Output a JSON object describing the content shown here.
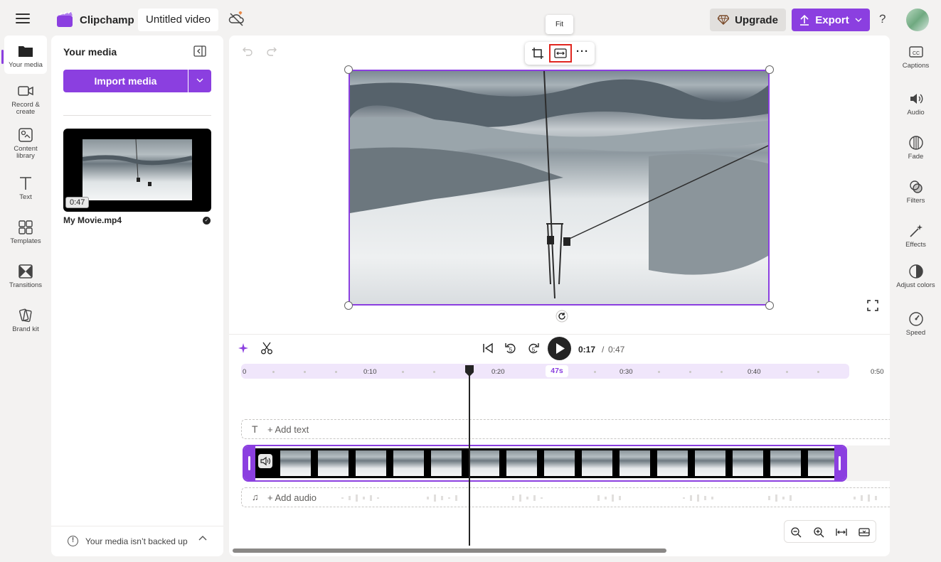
{
  "app": {
    "brand": "Clipchamp",
    "project_title": "Untitled video",
    "upgrade_label": "Upgrade",
    "export_label": "Export",
    "help_label": "?"
  },
  "left_nav": {
    "items": [
      {
        "label": "Your media",
        "icon": "folder-icon"
      },
      {
        "label": "Record & create",
        "icon": "camera-icon"
      },
      {
        "label": "Content library",
        "icon": "library-icon"
      },
      {
        "label": "Text",
        "icon": "text-icon"
      },
      {
        "label": "Templates",
        "icon": "templates-icon"
      },
      {
        "label": "Transitions",
        "icon": "transitions-icon"
      },
      {
        "label": "Brand kit",
        "icon": "brand-kit-icon"
      }
    ]
  },
  "media_panel": {
    "title": "Your media",
    "import_label": "Import media",
    "item": {
      "duration": "0:47",
      "name": "My Movie.mp4"
    },
    "backup_notice": "Your media isn’t backed up"
  },
  "preview": {
    "tooltip": "Fit",
    "more_label": "···"
  },
  "playback": {
    "current_time": "0:17",
    "separator": "/",
    "total_time": "0:47",
    "skip_back_label": "5",
    "skip_fwd_label": "5"
  },
  "timeline": {
    "ticks": [
      "0",
      "0:10",
      "0:20",
      "0:30",
      "0:40",
      "0:50"
    ],
    "duration_badge": "47s",
    "add_text_label": "+ Add text",
    "add_audio_label": "+ Add audio"
  },
  "right_nav": {
    "items": [
      {
        "label": "Captions",
        "icon": "captions-icon"
      },
      {
        "label": "Audio",
        "icon": "speaker-icon"
      },
      {
        "label": "Fade",
        "icon": "fade-icon"
      },
      {
        "label": "Filters",
        "icon": "filters-icon"
      },
      {
        "label": "Effects",
        "icon": "effects-wand-icon"
      },
      {
        "label": "Adjust colors",
        "icon": "adjust-colors-icon"
      },
      {
        "label": "Speed",
        "icon": "speed-icon"
      }
    ]
  },
  "colors": {
    "accent": "#8b3fe0",
    "highlight_box": "#e0261f",
    "ruler_bg": "#f0e6fb"
  }
}
